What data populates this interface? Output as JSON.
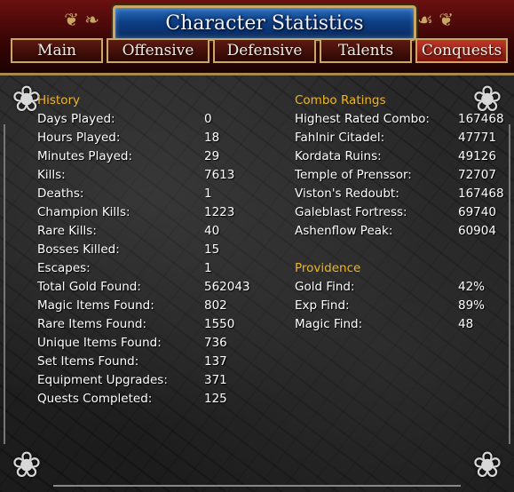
{
  "window": {
    "title": "Character Statistics"
  },
  "tabs": [
    {
      "label": "Main",
      "active": false
    },
    {
      "label": "Offensive",
      "active": false
    },
    {
      "label": "Defensive",
      "active": false
    },
    {
      "label": "Talents",
      "active": false
    },
    {
      "label": "Conquests",
      "active": true
    }
  ],
  "history": {
    "heading": "History",
    "rows": [
      {
        "label": "Days Played:",
        "value": "0"
      },
      {
        "label": "Hours Played:",
        "value": "18"
      },
      {
        "label": "Minutes Played:",
        "value": "29"
      },
      {
        "label": "Kills:",
        "value": "7613"
      },
      {
        "label": "Deaths:",
        "value": "1"
      },
      {
        "label": "Champion Kills:",
        "value": "1223"
      },
      {
        "label": "Rare Kills:",
        "value": "40"
      },
      {
        "label": "Bosses Killed:",
        "value": "15"
      },
      {
        "label": "Escapes:",
        "value": "1"
      },
      {
        "label": "Total Gold Found:",
        "value": "562043"
      },
      {
        "label": "Magic Items Found:",
        "value": "802"
      },
      {
        "label": "Rare Items Found:",
        "value": "1550"
      },
      {
        "label": "Unique Items Found:",
        "value": "736"
      },
      {
        "label": "Set Items Found:",
        "value": "137"
      },
      {
        "label": "Equipment Upgrades:",
        "value": "371"
      },
      {
        "label": "Quests Completed:",
        "value": "125"
      }
    ]
  },
  "combo": {
    "heading": "Combo Ratings",
    "rows": [
      {
        "label": "Highest Rated Combo:",
        "value": "167468"
      },
      {
        "label": "Fahlnir Citadel:",
        "value": "47771"
      },
      {
        "label": "Kordata Ruins:",
        "value": "49126"
      },
      {
        "label": "Temple of Prenssor:",
        "value": "72707"
      },
      {
        "label": "Viston's Redoubt:",
        "value": "167468"
      },
      {
        "label": "Galeblast Fortress:",
        "value": "69740"
      },
      {
        "label": "Ashenflow Peak:",
        "value": "60904"
      }
    ]
  },
  "providence": {
    "heading": "Providence",
    "rows": [
      {
        "label": "Gold Find:",
        "value": "42%"
      },
      {
        "label": "Exp Find:",
        "value": "89%"
      },
      {
        "label": "Magic Find:",
        "value": "48"
      }
    ]
  },
  "colors": {
    "heading": "#f0b51e",
    "text": "#ffffff",
    "active_tab": "#c0382a",
    "title_plate": "#0e3f86"
  }
}
